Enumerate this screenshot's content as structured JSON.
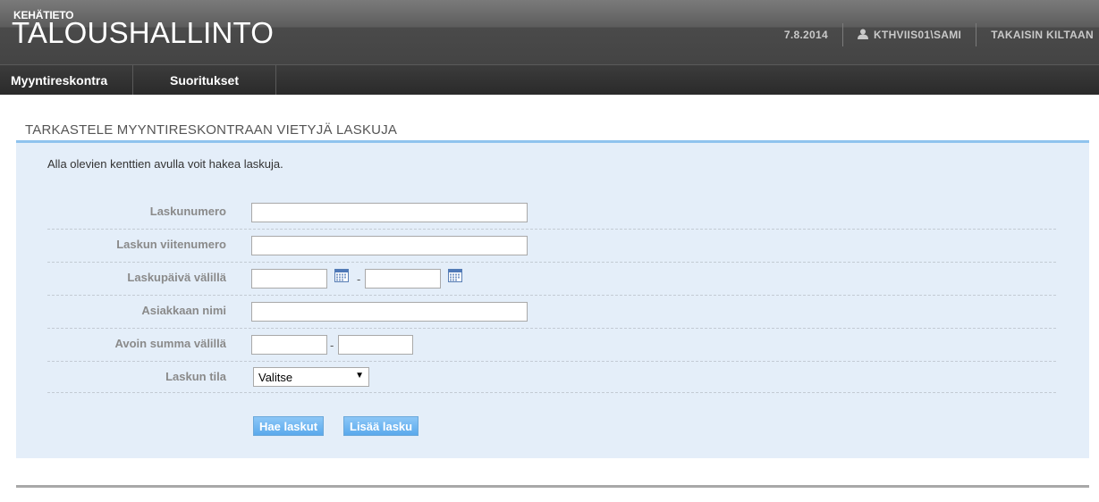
{
  "header": {
    "subtitle": "KEHÄTIETO",
    "title": "TALOUSHALLINTO",
    "date": "7.8.2014",
    "user": "KTHVIIS01\\SAMI",
    "back_link": "TAKAISIN KILTAAN"
  },
  "nav": {
    "items": [
      {
        "label": "Myyntireskontra"
      },
      {
        "label": "Suoritukset"
      }
    ]
  },
  "page": {
    "title": "TARKASTELE MYYNTIRESKONTRAAN VIETYJÄ LASKUJA",
    "intro": "Alla olevien kenttien avulla voit hakea laskuja."
  },
  "form": {
    "invoice_number_label": "Laskunumero",
    "invoice_number_value": "",
    "reference_label": "Laskun viitenumero",
    "reference_value": "",
    "date_range_label": "Laskupäivä välillä",
    "date_from_value": "",
    "date_to_value": "",
    "customer_label": "Asiakkaan nimi",
    "customer_value": "",
    "open_sum_label": "Avoin summa välillä",
    "sum_from_value": "",
    "sum_to_value": "",
    "range_separator": "-",
    "status_label": "Laskun tila",
    "status_selected": "Valitse",
    "search_button": "Hae laskut",
    "add_button": "Lisää lasku"
  },
  "colors": {
    "accent": "#8fc3ee",
    "panel": "#e4eef9",
    "button": "#6db5f0"
  }
}
